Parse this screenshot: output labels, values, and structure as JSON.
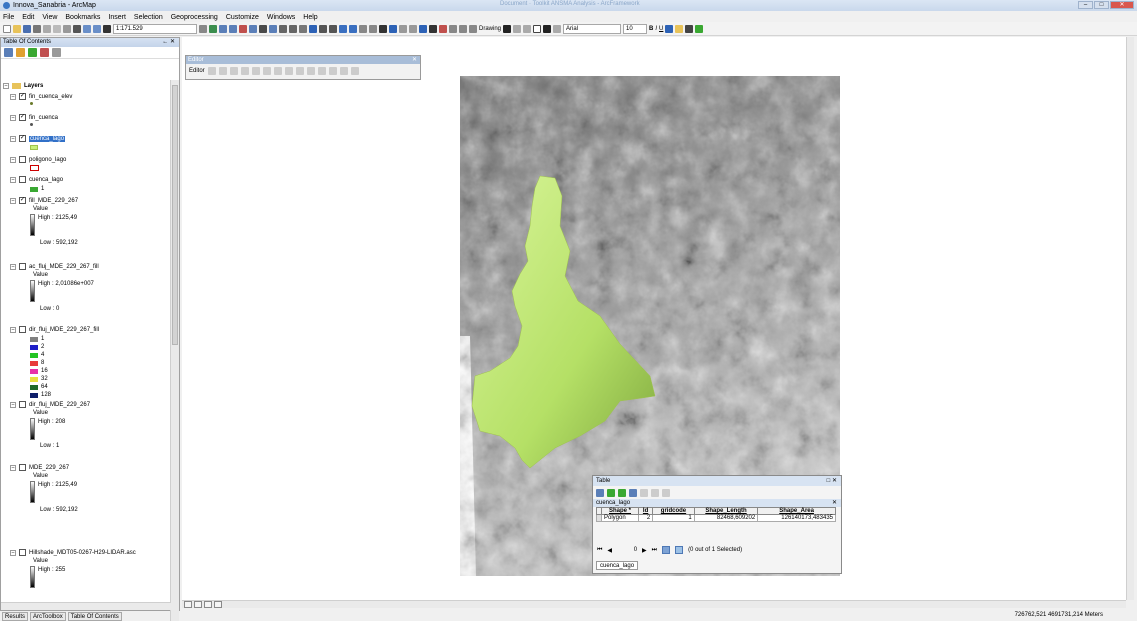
{
  "window": {
    "title": "Innova_Sanabria - ArcMap",
    "center_title": "Document · Toolkit ANSMA Analysis - ArcFramework"
  },
  "menu": [
    "File",
    "Edit",
    "View",
    "Bookmarks",
    "Insert",
    "Selection",
    "Geoprocessing",
    "Customize",
    "Windows",
    "Help"
  ],
  "toolbar": {
    "scale": "1:171.529",
    "drawing_label": "Drawing",
    "font": "Arial",
    "font_size": "10"
  },
  "toc": {
    "title": "Table Of Contents",
    "root": "Layers",
    "layers": [
      {
        "name": "fin_cuenca_elev",
        "checked": true
      },
      {
        "name": "fin_cuenca",
        "checked": true
      },
      {
        "name": "cuenca_lago",
        "checked": true,
        "selected": true,
        "swatch": "#c8f07a"
      },
      {
        "name": "poligono_lago",
        "checked": false,
        "swatch_outline": "#cc0000"
      },
      {
        "name": "cuenca_lago",
        "checked": false,
        "legend": [
          {
            "label": "1",
            "color": "#3aa832"
          }
        ]
      },
      {
        "name": "fill_MDE_229_267",
        "checked": true,
        "value_label": "Value",
        "high": "High : 2125,49",
        "low": "Low : 592,192"
      },
      {
        "name": "ac_fluj_MDE_229_267_fill",
        "checked": false,
        "value_label": "Value",
        "high": "High : 2,01086e+007",
        "low": "Low : 0"
      },
      {
        "name": "dir_fluj_MDE_229_267_fill",
        "checked": false,
        "legend": [
          {
            "label": "1",
            "color": "#808080"
          },
          {
            "label": "2",
            "color": "#1f1fc8"
          },
          {
            "label": "4",
            "color": "#22c422"
          },
          {
            "label": "8",
            "color": "#e83b3b"
          },
          {
            "label": "16",
            "color": "#e830a8"
          },
          {
            "label": "32",
            "color": "#e8e040"
          },
          {
            "label": "64",
            "color": "#1e6a2a"
          },
          {
            "label": "128",
            "color": "#0e1e6a"
          }
        ]
      },
      {
        "name": "dir_fluj_MDE_229_267",
        "checked": false,
        "value_label": "Value",
        "high": "High : 208",
        "low": "Low : 1"
      },
      {
        "name": "MDE_229_267",
        "checked": false,
        "value_label": "Value",
        "high": "High : 2125,49",
        "low": "Low : 592,192"
      },
      {
        "name": "Hillshade_MDT05-0267-H29-LIDAR.asc",
        "checked": false,
        "value_label": "Value",
        "high": "High : 255"
      }
    ]
  },
  "bottom_tabs": [
    "Results",
    "ArcToolbox",
    "Table Of Contents"
  ],
  "editor": {
    "title": "Editor",
    "menu_label": "Editor"
  },
  "table": {
    "title": "Table",
    "layer_tab": "cuenca_lago",
    "columns": [
      "Shape *",
      "Id",
      "gridcode",
      "Shape_Length",
      "Shape_Area"
    ],
    "rows": [
      [
        "Polygon",
        "2",
        "1",
        "82468,609202",
        "126140173,483435"
      ]
    ],
    "nav_record": "0",
    "selection_status": "(0 out of 1 Selected)",
    "bottom_tab": "cuenca_lago"
  },
  "status": {
    "coordinates": "726762,521  4691731,214 Meters"
  }
}
